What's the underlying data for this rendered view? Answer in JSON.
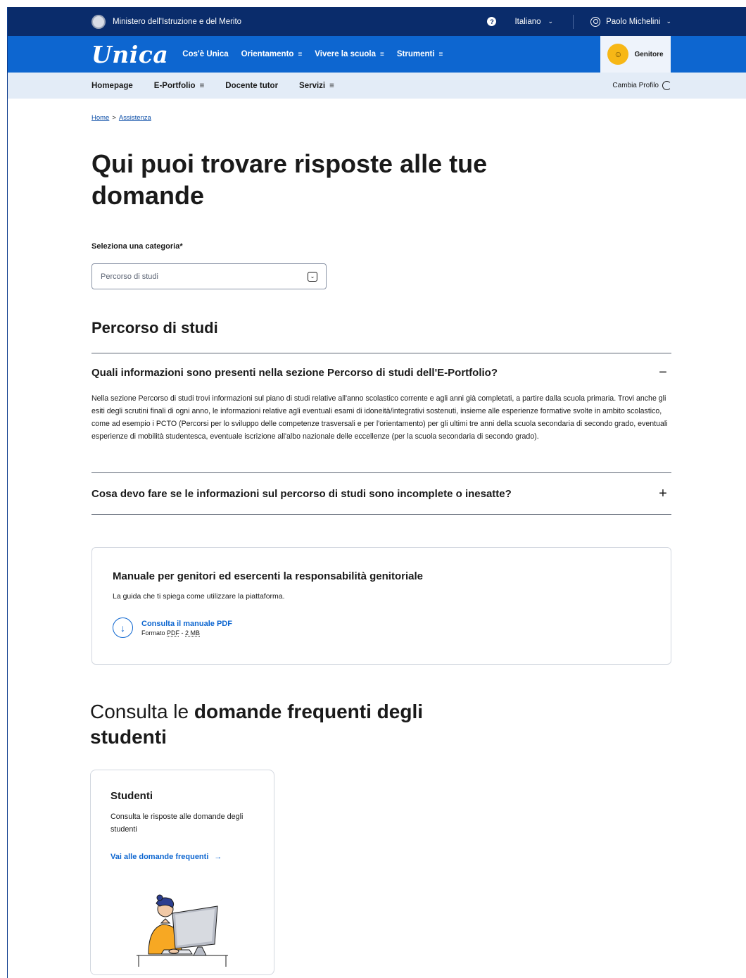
{
  "topbar": {
    "ministry": "Ministero dell'Istruzione e del Merito",
    "language": "Italiano",
    "user": "Paolo Michelini"
  },
  "mainnav": {
    "logo": "Unica",
    "links": [
      "Cos'è Unica",
      "Orientamento",
      "Vivere la scuola",
      "Strumenti"
    ],
    "profile_label": "Genitore"
  },
  "subnav": {
    "links": [
      "Homepage",
      "E-Portfolio",
      "Docente tutor",
      "Servizi"
    ],
    "cambia": "Cambia Profilo"
  },
  "breadcrumb": {
    "home": "Home",
    "sep": ">",
    "current": "Assistenza"
  },
  "page": {
    "title": "Qui puoi trovare risposte alle tue domande",
    "category_label": "Seleziona una categoria*",
    "category_value": "Percorso di studi",
    "section_title": "Percorso di studi"
  },
  "accordion": [
    {
      "question": "Quali informazioni sono presenti nella sezione Percorso di studi dell'E-Portfolio?",
      "toggle": "−",
      "answer": "Nella sezione Percorso di studi trovi informazioni sul piano di studi relative all'anno scolastico corrente e agli anni già completati, a partire dalla scuola primaria. Trovi anche gli esiti degli scrutini finali di ogni anno, le informazioni relative agli eventuali esami di idoneità/integrativi sostenuti, insieme alle esperienze formative svolte in ambito scolastico, come ad esempio i PCTO (Percorsi per lo sviluppo delle competenze trasversali e per l'orientamento) per gli ultimi tre anni della scuola secondaria di secondo grado, eventuali esperienze di mobilità studentesca, eventuale iscrizione all'albo nazionale delle eccellenze (per la scuola secondaria di secondo grado)."
    },
    {
      "question": "Cosa devo fare se le informazioni sul percorso di studi sono incomplete o inesatte?",
      "toggle": "+"
    }
  ],
  "manual": {
    "title": "Manuale per genitori ed esercenti la responsabilità genitoriale",
    "desc": "La guida che ti spiega come utilizzare la piattaforma.",
    "link": "Consulta il manuale PDF",
    "format_prefix": "Formato",
    "format_type": "PDF",
    "format_size": "2 MB"
  },
  "faq": {
    "title_plain": "Consulta le ",
    "title_bold": "domande frequenti degli studenti",
    "card_title": "Studenti",
    "card_desc": "Consulta le risposte alle domande degli studenti",
    "card_link": "Vai alle domande frequenti"
  },
  "colors": {
    "navy": "#0a2c6b",
    "blue": "#0d66d0",
    "subnav": "#e3ecf7",
    "accent": "#f7b716"
  }
}
